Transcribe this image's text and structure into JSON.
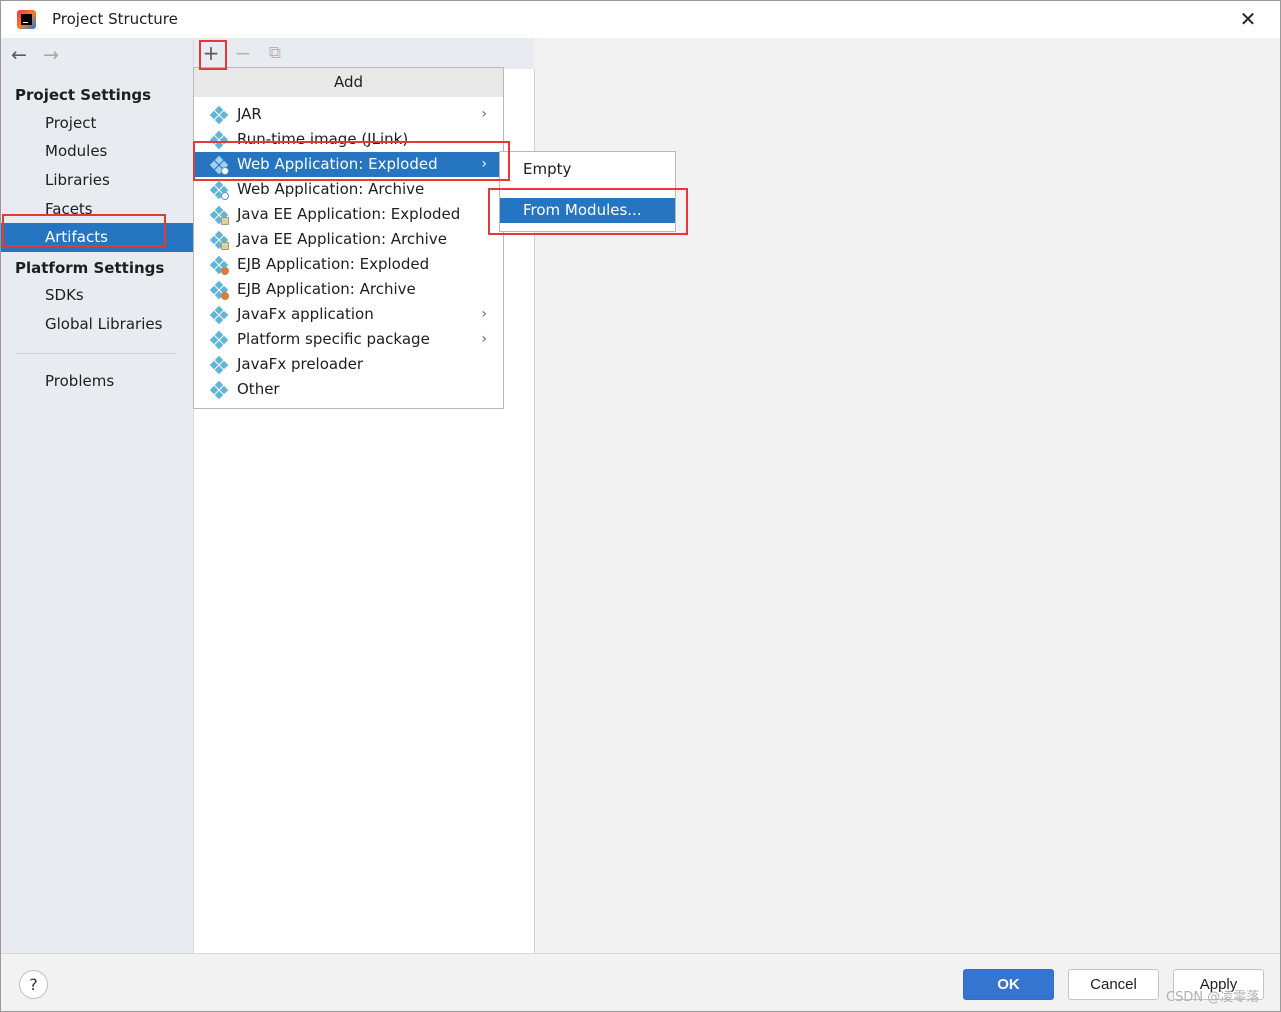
{
  "window": {
    "title": "Project Structure",
    "close_glyph": "✕"
  },
  "sidebar": {
    "back_glyph": "←",
    "forward_glyph": "→",
    "project_settings_title": "Project Settings",
    "project_items": [
      {
        "label": "Project"
      },
      {
        "label": "Modules"
      },
      {
        "label": "Libraries"
      },
      {
        "label": "Facets"
      },
      {
        "label": "Artifacts",
        "selected": true
      }
    ],
    "platform_settings_title": "Platform Settings",
    "platform_items": [
      {
        "label": "SDKs"
      },
      {
        "label": "Global Libraries"
      }
    ],
    "problems_label": "Problems"
  },
  "toolbar": {
    "add_glyph": "+",
    "remove_glyph": "−",
    "copy_glyph": "⧉"
  },
  "add_popup": {
    "header": "Add",
    "items": [
      {
        "label": "JAR",
        "icon": "jar-artifact-icon",
        "submenu": true
      },
      {
        "label": "Run-time image (JLink)",
        "icon": "jlink-artifact-icon",
        "submenu": false
      },
      {
        "label": "Web Application: Exploded",
        "icon": "web-artifact-icon",
        "submenu": true,
        "selected": true
      },
      {
        "label": "Web Application: Archive",
        "icon": "web-artifact-icon",
        "submenu": false
      },
      {
        "label": "Java EE Application: Exploded",
        "icon": "javaee-artifact-icon",
        "submenu": false
      },
      {
        "label": "Java EE Application: Archive",
        "icon": "javaee-artifact-icon",
        "submenu": false
      },
      {
        "label": "EJB Application: Exploded",
        "icon": "ejb-artifact-icon",
        "submenu": false
      },
      {
        "label": "EJB Application: Archive",
        "icon": "ejb-artifact-icon",
        "submenu": false
      },
      {
        "label": "JavaFx application",
        "icon": "javafx-artifact-icon",
        "submenu": true
      },
      {
        "label": "Platform specific package",
        "icon": "platform-artifact-icon",
        "submenu": true
      },
      {
        "label": "JavaFx preloader",
        "icon": "javafx-artifact-icon",
        "submenu": false
      },
      {
        "label": "Other",
        "icon": "other-artifact-icon",
        "submenu": false
      }
    ],
    "submenu_arrow": "›"
  },
  "submenu": {
    "items": [
      {
        "label": "Empty"
      },
      {
        "label": "From Modules...",
        "selected": true
      }
    ]
  },
  "footer": {
    "help_glyph": "?",
    "ok_label": "OK",
    "cancel_label": "Cancel",
    "apply_label": "Apply",
    "watermark": "CSDN @凌零落"
  },
  "colors": {
    "selection": "#2675c1",
    "annotation_red": "#e53935",
    "ok_button": "#3574d1"
  }
}
